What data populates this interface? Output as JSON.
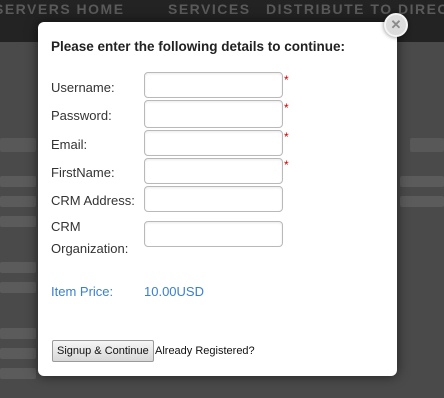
{
  "background_nav": {
    "items": [
      "SERVERS HOME",
      "SERVICES",
      "DISTRIBUTE TO DIRECT"
    ]
  },
  "modal": {
    "title": "Please enter the following details to continue:",
    "close_icon": "close-icon",
    "fields": [
      {
        "label": "Username:",
        "value": "",
        "required": true
      },
      {
        "label": "Password:",
        "value": "",
        "required": true
      },
      {
        "label": "Email:",
        "value": "",
        "required": true
      },
      {
        "label": "FirstName:",
        "value": "",
        "required": true
      },
      {
        "label": "CRM Address:",
        "value": "",
        "required": false
      },
      {
        "label": "CRM",
        "label_line2": "Organization:",
        "value": "",
        "required": false
      }
    ],
    "required_marker": "*",
    "price": {
      "label": "Item Price:",
      "value": "10.00USD"
    },
    "signup_button": "Signup & Continue",
    "registered_link": "Already Registered?"
  },
  "colors": {
    "price_text": "#3a7fd1",
    "required_star": "#d00000",
    "overlay": "#444444"
  }
}
